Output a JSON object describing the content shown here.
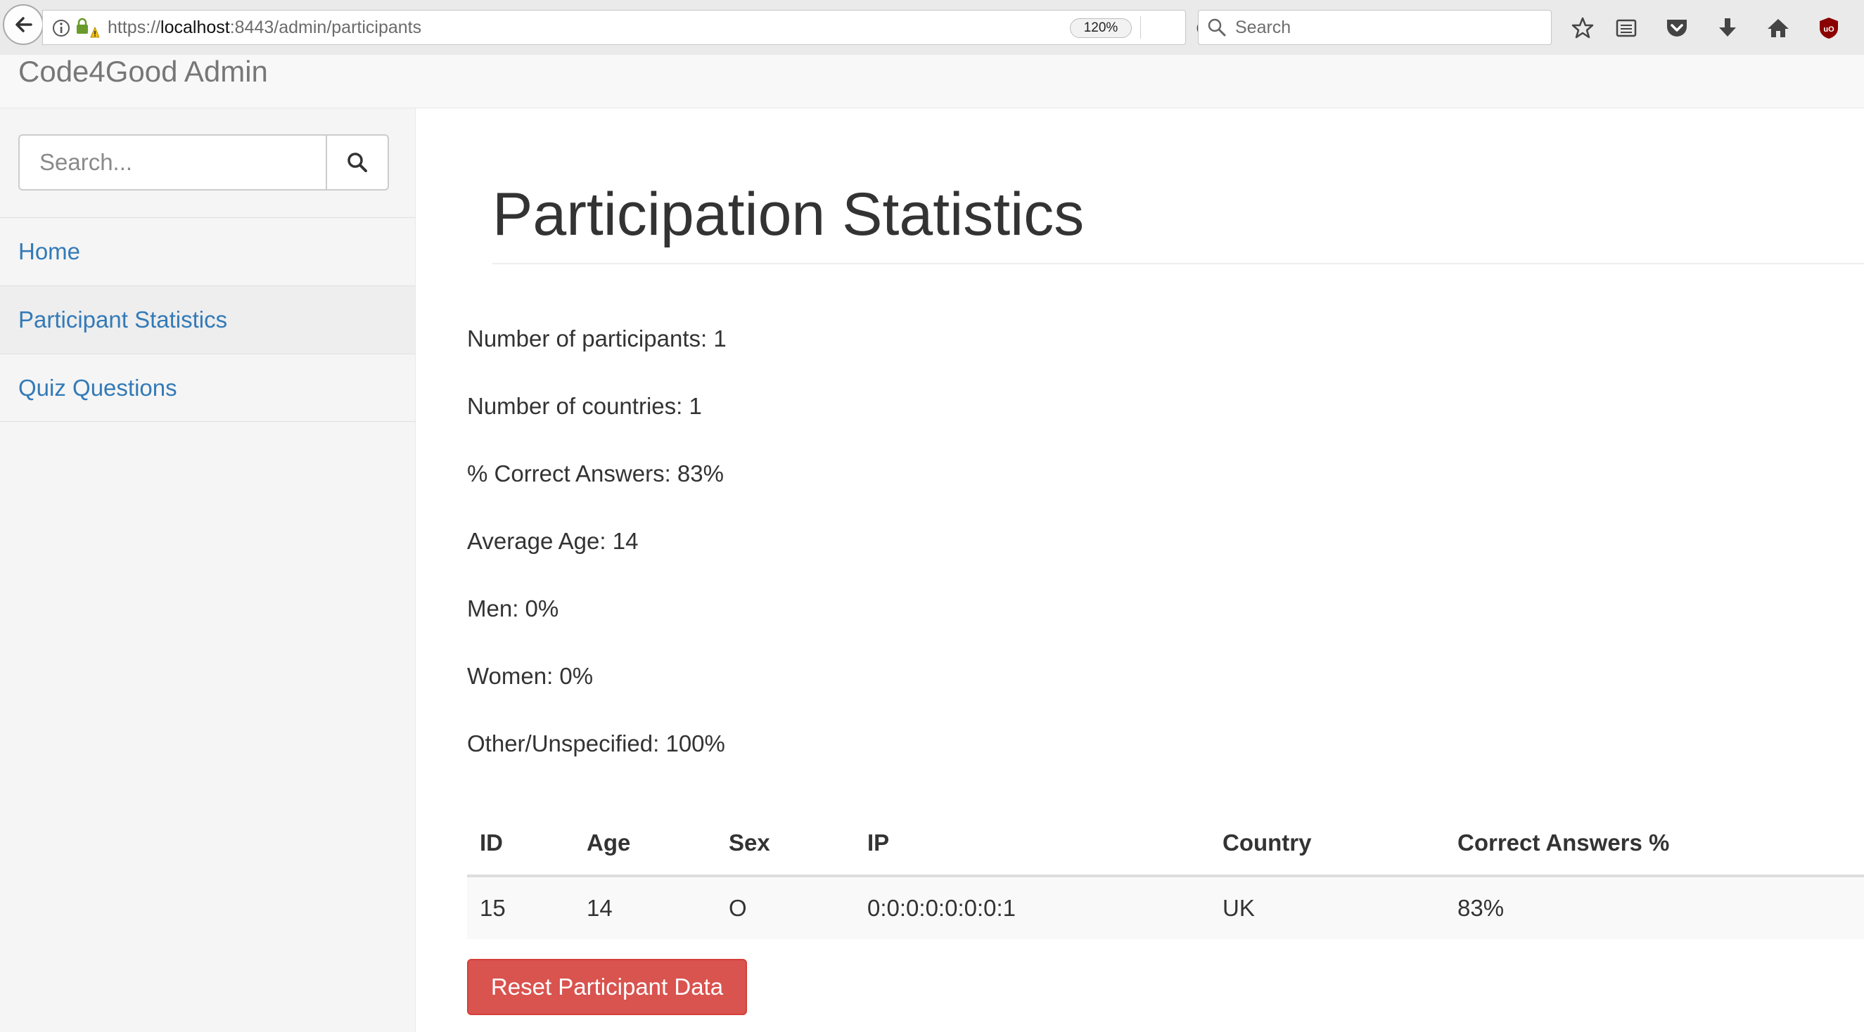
{
  "browser": {
    "url_prefix": "https://",
    "url_host": "localhost",
    "url_rest": ":8443/admin/participants",
    "zoom": "120%",
    "search_placeholder": "Search"
  },
  "navbar": {
    "brand": "Code4Good Admin"
  },
  "sidebar": {
    "search_placeholder": "Search...",
    "items": [
      {
        "label": "Home",
        "active": false
      },
      {
        "label": "Participant Statistics",
        "active": true
      },
      {
        "label": "Quiz Questions",
        "active": false
      }
    ]
  },
  "main": {
    "title": "Participation Statistics",
    "stats": [
      "Number of participants: 1",
      "Number of countries: 1",
      "% Correct Answers: 83%",
      "Average Age: 14",
      "Men: 0%",
      "Women: 0%",
      "Other/Unspecified: 100%"
    ],
    "table": {
      "headers": [
        "ID",
        "Age",
        "Sex",
        "IP",
        "Country",
        "Correct Answers %"
      ],
      "rows": [
        [
          "15",
          "14",
          "O",
          "0:0:0:0:0:0:0:1",
          "UK",
          "83%"
        ]
      ]
    },
    "reset_label": "Reset Participant Data"
  },
  "colors": {
    "link": "#337ab7",
    "danger": "#d9534f",
    "brand_text": "#777777"
  }
}
